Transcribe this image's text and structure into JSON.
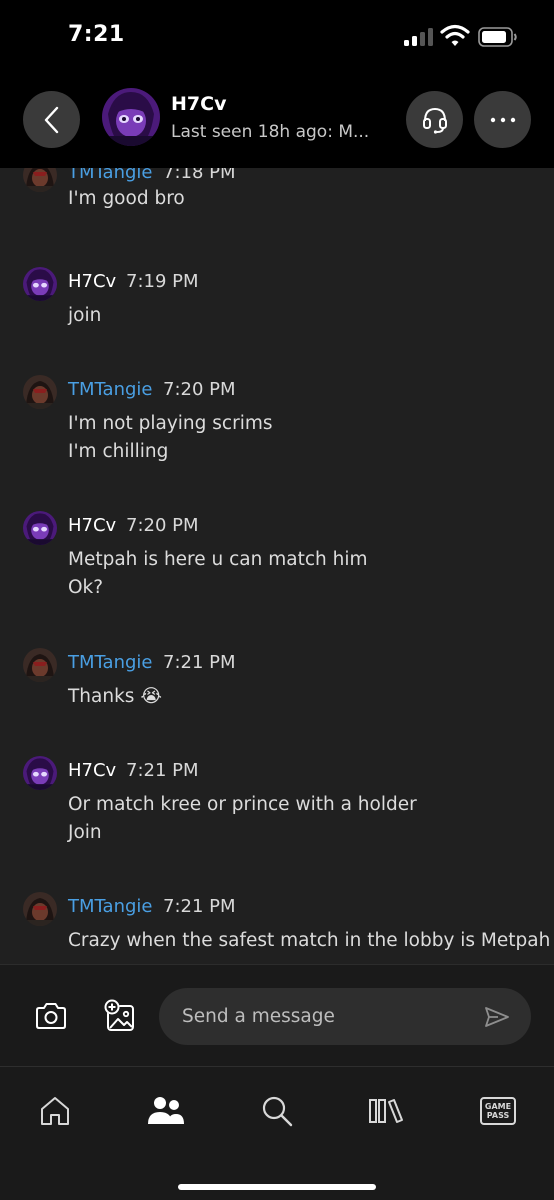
{
  "status_bar": {
    "time": "7:21"
  },
  "header": {
    "contact_name": "H7Cv",
    "contact_status": "Last seen 18h ago: M..."
  },
  "messages": [
    {
      "sender": "TMTangie",
      "time": "7:18 PM",
      "lines": [
        "I'm good bro"
      ]
    },
    {
      "sender": "H7Cv",
      "time": "7:19 PM",
      "lines": [
        "join"
      ]
    },
    {
      "sender": "TMTangie",
      "time": "7:20 PM",
      "lines": [
        "I'm not playing scrims",
        "I'm chilling"
      ]
    },
    {
      "sender": "H7Cv",
      "time": "7:20 PM",
      "lines": [
        "Metpah is here u can match him",
        "Ok?"
      ]
    },
    {
      "sender": "TMTangie",
      "time": "7:21 PM",
      "lines": [
        "Thanks 😭"
      ]
    },
    {
      "sender": "H7Cv",
      "time": "7:21 PM",
      "lines": [
        "Or match kree or prince with a holder",
        "Join"
      ]
    },
    {
      "sender": "TMTangie",
      "time": "7:21 PM",
      "lines": [
        "Crazy when the safest match in the lobby is Metpah"
      ]
    }
  ],
  "composer": {
    "placeholder": "Send a message"
  },
  "nav": {
    "items": [
      "home-icon",
      "people-icon",
      "search-icon",
      "library-icon",
      "game-pass-icon"
    ],
    "game_pass_line1": "GAME",
    "game_pass_line2": "PASS"
  },
  "colors": {
    "background": "#202020",
    "header_background": "#000000",
    "button_background": "#3a3a3a",
    "friend_name": "#4a9fe3",
    "message_text": "#dcdcdc"
  }
}
